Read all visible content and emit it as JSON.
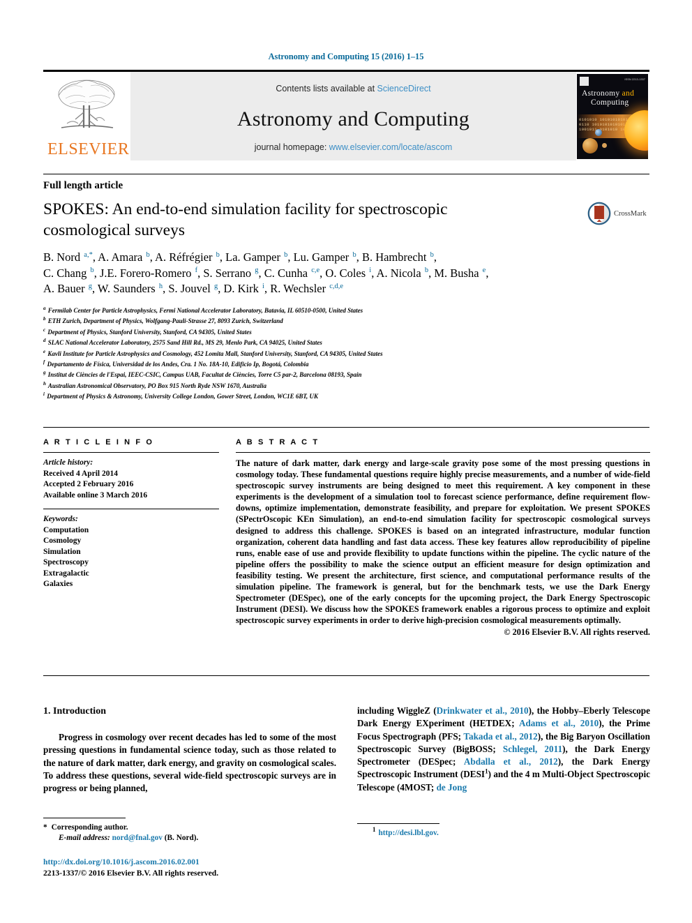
{
  "colors": {
    "link": "#1b7aad",
    "running_head": "#0b6b9a",
    "elsevier_orange": "#e87722",
    "band_gray": "#ececec",
    "sciencedirect_blue": "#3d8fc6"
  },
  "running_head": "Astronomy and Computing 15 (2016) 1–15",
  "masthead": {
    "publisher_name": "ELSEVIER",
    "contents_prefix": "Contents lists available at",
    "contents_link": "ScienceDirect",
    "journal_title": "Astronomy and Computing",
    "homepage_prefix": "journal homepage:",
    "homepage_link": "www.elsevier.com/locate/ascom",
    "cover": {
      "title_line1": "Astronomy",
      "title_accent": "and",
      "title_line2": "Computing",
      "binary_row1": "0101010 1010101010101010101010",
      "binary_row2": "0110 1010101010101000101",
      "binary_row3": "1001011 0101010 1010010101",
      "issn": "ISSN 2213-1337"
    }
  },
  "article": {
    "type": "Full length article",
    "title": "SPOKES: An end-to-end simulation facility for spectroscopic cosmological surveys",
    "crossmark_label": "CrossMark"
  },
  "authors_html": "B. Nord <sup>a,*</sup>, A. Amara <sup>b</sup>, A. R&eacute;fr&eacute;gier <sup>b</sup>, La. Gamper <sup>b</sup>, Lu. Gamper <sup>b</sup>, B. Hambrecht <sup>b</sup>,<br>C. Chang <sup>b</sup>, J.E. Forero-Romero <sup>f</sup>, S. Serrano <sup>g</sup>, C. Cunha <sup>c,e</sup>, O. Coles <sup>i</sup>, A. Nicola <sup>b</sup>, M. Busha <sup>e</sup>,<br>A. Bauer <sup>g</sup>, W. Saunders <sup>h</sup>, S. Jouvel <sup>g</sup>, D. Kirk <sup>i</sup>, R. Wechsler <sup>c,d,e</sup>",
  "affiliations": [
    {
      "marker": "a",
      "text": "Fermilab Center for Particle Astrophysics, Fermi National Accelerator Laboratory, Batavia, IL 60510-0500, United States"
    },
    {
      "marker": "b",
      "text": "ETH Zurich, Department of Physics, Wolfgang-Pauli-Strasse 27, 8093 Zurich, Switzerland"
    },
    {
      "marker": "c",
      "text": "Department of Physics, Stanford University, Stanford, CA 94305, United States"
    },
    {
      "marker": "d",
      "text": "SLAC National Accelerator Laboratory, 2575 Sand Hill Rd., MS 29, Menlo Park, CA 94025, United States"
    },
    {
      "marker": "e",
      "text": "Kavli Institute for Particle Astrophysics and Cosmology, 452 Lomita Mall, Stanford University, Stanford, CA 94305, United States"
    },
    {
      "marker": "f",
      "text": "Departamento de Física, Universidad de los Andes, Cra. 1 No. 18A-10, Edificio Ip, Bogotá, Colombia"
    },
    {
      "marker": "g",
      "text": "Institut de Ciències de l'Espai, IEEC-CSIC, Campus UAB, Facultat de Ciències, Torre C5 par-2, Barcelona 08193, Spain"
    },
    {
      "marker": "h",
      "text": "Australian Astronomical Observatory, PO Box 915 North Ryde NSW 1670, Australia"
    },
    {
      "marker": "i",
      "text": "Department of Physics & Astronomy, University College London, Gower Street, London, WC1E 6BT, UK"
    }
  ],
  "article_info": {
    "heading": "A R T I C L E   I N F O",
    "history_label": "Article history:",
    "history": [
      "Received 4 April 2014",
      "Accepted 2 February 2016",
      "Available online 3 March 2016"
    ],
    "keywords_label": "Keywords:",
    "keywords": [
      "Computation",
      "Cosmology",
      "Simulation",
      "Spectroscopy",
      "Extragalactic",
      "Galaxies"
    ]
  },
  "abstract": {
    "heading": "A B S T R A C T",
    "body": "The nature of dark matter, dark energy and large-scale gravity pose some of the most pressing questions in cosmology today. These fundamental questions require highly precise measurements, and a number of wide-field spectroscopic survey instruments are being designed to meet this requirement. A key component in these experiments is the development of a simulation tool to forecast science performance, define requirement flow-downs, optimize implementation, demonstrate feasibility, and prepare for exploitation. We present SPOKES (SPectrOscopic KEn Simulation), an end-to-end simulation facility for spectroscopic cosmological surveys designed to address this challenge. SPOKES is based on an integrated infrastructure, modular function organization, coherent data handling and fast data access. These key features allow reproducibility of pipeline runs, enable ease of use and provide flexibility to update functions within the pipeline. The cyclic nature of the pipeline offers the possibility to make the science output an efficient measure for design optimization and feasibility testing. We present the architecture, first science, and computational performance results of the simulation pipeline. The framework is general, but for the benchmark tests, we use the Dark Energy Spectrometer (DESpec), one of the early concepts for the upcoming project, the Dark Energy Spectroscopic Instrument (DESI). We discuss how the SPOKES framework enables a rigorous process to optimize and exploit spectroscopic survey experiments in order to derive high-precision cosmological measurements optimally.",
    "copyright": "© 2016 Elsevier B.V. All rights reserved."
  },
  "body": {
    "section_number_title": "1. Introduction",
    "left_paragraph": "Progress in cosmology over recent decades has led to some of the most pressing questions in fundamental science today, such as those related to the nature of dark matter, dark energy, and gravity on cosmological scales. To address these questions, several wide-field spectroscopic surveys are in progress or being planned,",
    "right_paragraph_html": "including WiggleZ (<span class=\"lnk\">Drinkwater et al., 2010</span>), the Hobby–Eberly Telescope Dark Energy EXperiment (HETDEX; <span class=\"lnk\">Adams et al., 2010</span>), the Prime Focus Spectrograph (PFS; <span class=\"lnk\">Takada et al., 2012</span>), the Big Baryon Oscillation Spectroscopic  Survey (BigBOSS; <span class=\"lnk\">Schlegel, 2011</span>), the Dark Energy Spectrometer (DESpec; <span class=\"lnk\">Abdalla et al., 2012</span>), the Dark Energy Spectroscopic Instrument (DESI<sup>1</sup>) and the 4 m Multi-Object Spectroscopic Telescope (4MOST; <span class=\"lnk\">de Jong</span>"
  },
  "footnotes": {
    "corresponding_marker": "*",
    "corresponding_label": "Corresponding author.",
    "email_label": "E-mail address:",
    "email_link": "nord@fnal.gov",
    "email_suffix": "(B. Nord).",
    "doi_link": "http://dx.doi.org/10.1016/j.ascom.2016.02.001",
    "issn_copyright": "2213-1337/© 2016 Elsevier B.V. All rights reserved.",
    "right_marker": "1",
    "right_link": "http://desi.lbl.gov."
  }
}
